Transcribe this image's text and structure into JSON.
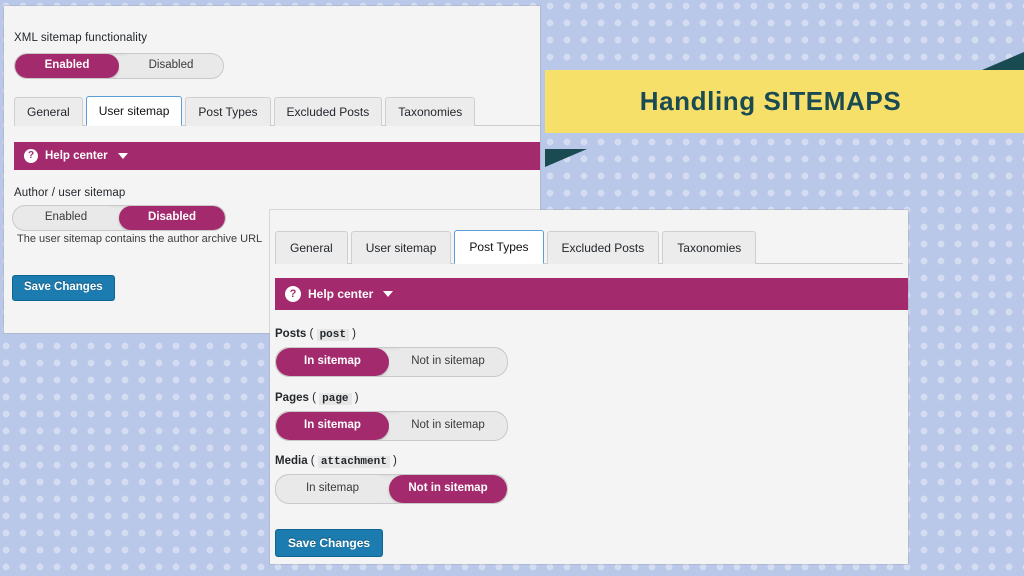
{
  "banner": {
    "title": "Handling SITEMAPS",
    "bg_color": "#f7e06a",
    "text_color": "#1a4a52",
    "fold_color": "#1a4a52"
  },
  "theme": {
    "accent_magenta": "#a42a6e",
    "accent_blue": "#1c7cb0",
    "tab_active_border": "#5b9dd9",
    "panel_bg": "#f4f4f4",
    "page_bg": "#b9c7e9"
  },
  "panel_user_sitemap": {
    "functionality_label": "XML sitemap functionality",
    "functionality_toggle": {
      "enabled_label": "Enabled",
      "disabled_label": "Disabled",
      "selected": "Enabled"
    },
    "tabs": [
      {
        "label": "General",
        "active": false
      },
      {
        "label": "User sitemap",
        "active": true
      },
      {
        "label": "Post Types",
        "active": false
      },
      {
        "label": "Excluded Posts",
        "active": false
      },
      {
        "label": "Taxonomies",
        "active": false
      }
    ],
    "help_center": {
      "icon": "question-mark-icon",
      "label": "Help center",
      "caret": "chevron-down-icon"
    },
    "author_label": "Author / user sitemap",
    "author_toggle": {
      "enabled_label": "Enabled",
      "disabled_label": "Disabled",
      "selected": "Disabled"
    },
    "hint": "The user sitemap contains the author archive URL",
    "save_label": "Save Changes"
  },
  "panel_post_types": {
    "tabs": [
      {
        "label": "General",
        "active": false
      },
      {
        "label": "User sitemap",
        "active": false
      },
      {
        "label": "Post Types",
        "active": true
      },
      {
        "label": "Excluded Posts",
        "active": false
      },
      {
        "label": "Taxonomies",
        "active": false
      }
    ],
    "help_center": {
      "icon": "question-mark-icon",
      "label": "Help center",
      "caret": "chevron-down-icon"
    },
    "rows": [
      {
        "name": "Posts",
        "slug": "post",
        "in_label": "In sitemap",
        "not_in_label": "Not in sitemap",
        "selected": "In sitemap"
      },
      {
        "name": "Pages",
        "slug": "page",
        "in_label": "In sitemap",
        "not_in_label": "Not in sitemap",
        "selected": "In sitemap"
      },
      {
        "name": "Media",
        "slug": "attachment",
        "in_label": "In sitemap",
        "not_in_label": "Not in sitemap",
        "selected": "Not in sitemap"
      }
    ],
    "save_label": "Save Changes"
  }
}
